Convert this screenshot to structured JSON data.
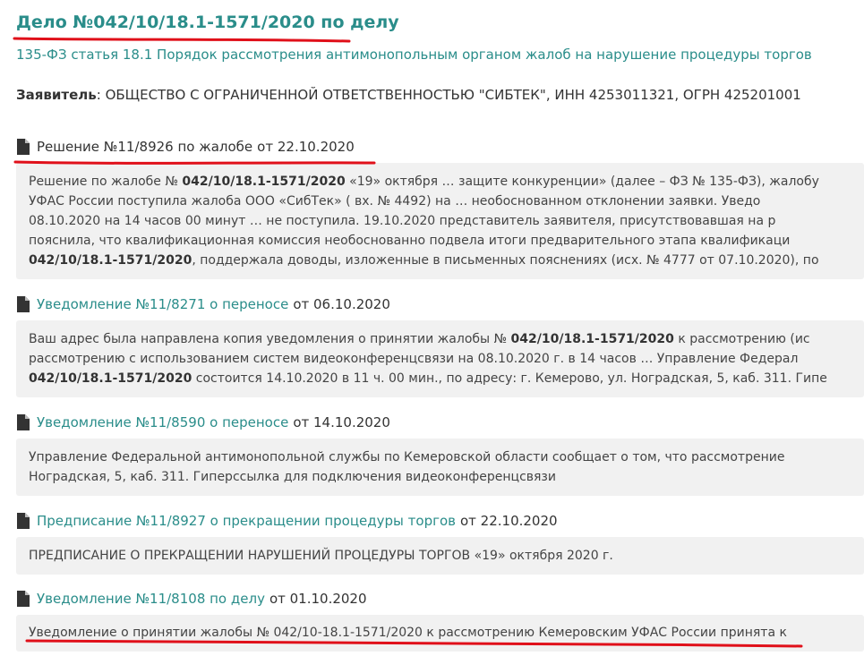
{
  "case": {
    "title": "Дело №042/10/18.1-1571/2020 по делу",
    "subtitle": "135-ФЗ статья 18.1 Порядок рассмотрения антимонопольным органом жалоб на нарушение процедуры торгов",
    "applicant_label": "Заявитель",
    "applicant_value": ": ОБЩЕСТВО С ОГРАНИЧЕННОЙ ОТВЕТСТВЕННОСТЬЮ \"СИБТЕК\", ИНН 4253011321, ОГРН 425201001"
  },
  "documents": [
    {
      "title": "Решение №11/8926 по жалобе",
      "date": "от 22.10.2020",
      "lines": [
        [
          "Решение по жалобе № ",
          "042/10/18.1-1571/2020",
          " «19» октября … защите конкуренции» (далее – ФЗ № 135-ФЗ), жалобу"
        ],
        [
          "УФАС России поступила  жалоба ООО «СибТек» ( вх. № 4492) на … необоснованном отклонении заявки.        Уведо"
        ],
        [
          "08.10.2020 на 14 часов 00 минут … не поступила.         19.10.2020 представитель заявителя, присутствовавшая на р"
        ],
        [
          "пояснила, что квалификационная комиссия необоснованно подвела итоги предварительного этапа квалификаци"
        ],
        [
          "",
          "042/10/18.1-1571/2020",
          ", поддержала доводы, изложенные в письменных пояснениях (исх. № 4777 от 07.10.2020), по"
        ]
      ]
    },
    {
      "title": "Уведомление №11/8271 о переносе",
      "date": "от 06.10.2020",
      "lines": [
        [
          "Ваш адрес была направлена копия уведомления о принятии жалобы № ",
          "042/10/18.1-1571/2020",
          " к рассмотрению (ис"
        ],
        [
          "рассмотрению с использованием систем видеоконференцсвязи на 08.10.2020 г. в 14 часов … Управление Федерал"
        ],
        [
          "",
          "042/10/18.1-1571/2020",
          " состоится 14.10.2020 в 11 ч. 00 мин., по адресу: г. Кемерово, ул. Ноградская, 5, каб. 311. Гипе"
        ]
      ]
    },
    {
      "title": "Уведомление №11/8590 о переносе",
      "date": "от 14.10.2020",
      "lines": [
        [
          "Управление Федеральной антимонопольной службы по Кемеровской области сообщает о том, что рассмотрение"
        ],
        [
          "Ноградская, 5, каб. 311. Гиперссылка для подключения видеоконференцсвязи"
        ]
      ]
    },
    {
      "title": "Предписание №11/8927 о прекращении процедуры торгов",
      "date": "от 22.10.2020",
      "lines": [
        [
          "ПРЕДПИСАНИЕ О ПРЕКРАЩЕНИИ НАРУШЕНИЙ ПРОЦЕДУРЫ ТОРГОВ «19» октября 2020 г."
        ]
      ]
    },
    {
      "title": "Уведомление №11/8108 по делу",
      "date": "от 01.10.2020",
      "lines": [
        [
          "Уведомление о принятии жалобы № 042/10-18.1-1571/2020 к рассмотрению   Кемеровским УФАС России принята к"
        ]
      ]
    }
  ],
  "colors": {
    "link": "#2a8d8a",
    "annotation": "#e0101a",
    "panel": "#f1f1f1"
  },
  "icons": [
    "file-icon"
  ]
}
